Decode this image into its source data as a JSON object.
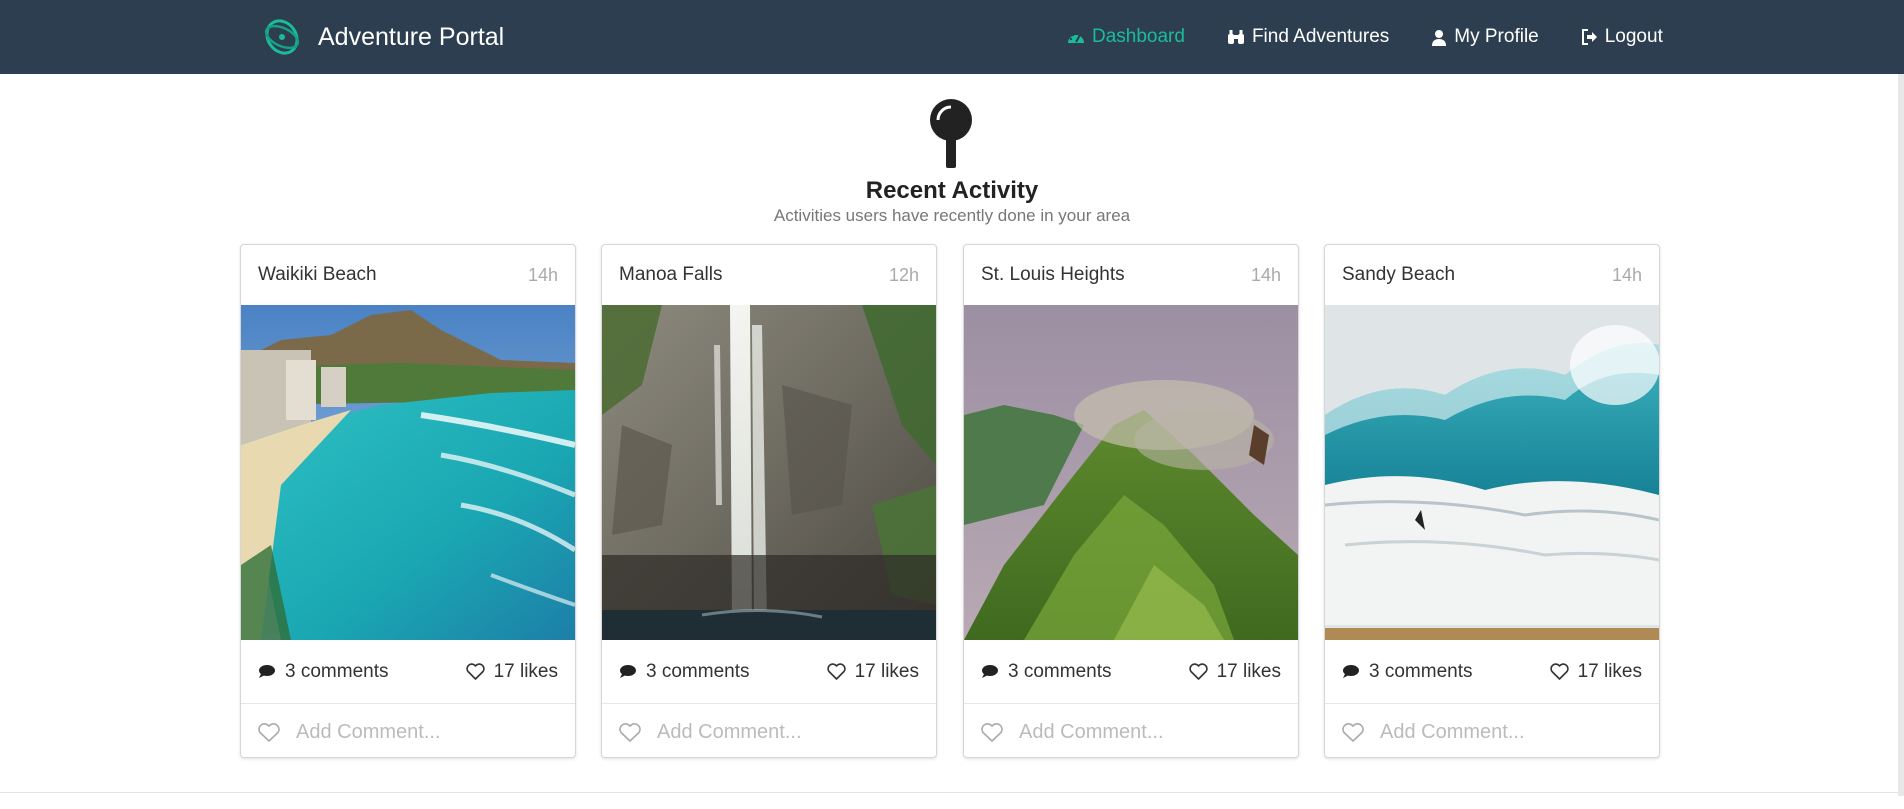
{
  "app": {
    "title": "Adventure Portal"
  },
  "nav": [
    {
      "label": "Dashboard",
      "icon": "dashboard-icon",
      "active": true
    },
    {
      "label": "Find Adventures",
      "icon": "binoculars-icon",
      "active": false
    },
    {
      "label": "My Profile",
      "icon": "user-icon",
      "active": false
    },
    {
      "label": "Logout",
      "icon": "sign-out-icon",
      "active": false
    }
  ],
  "header": {
    "icon": "map-pin-icon",
    "title": "Recent Activity",
    "subtitle": "Activities users have recently done in your area"
  },
  "cards": [
    {
      "name": "Waikiki Beach",
      "time": "14h",
      "comments": "3 comments",
      "likes": "17 likes",
      "comment_placeholder": "Add Comment...",
      "photo": "beach-aerial"
    },
    {
      "name": "Manoa Falls",
      "time": "12h",
      "comments": "3 comments",
      "likes": "17 likes",
      "comment_placeholder": "Add Comment...",
      "photo": "waterfall"
    },
    {
      "name": "St. Louis Heights",
      "time": "14h",
      "comments": "3 comments",
      "likes": "17 likes",
      "comment_placeholder": "Add Comment...",
      "photo": "mountain-ridge"
    },
    {
      "name": "Sandy Beach",
      "time": "14h",
      "comments": "3 comments",
      "likes": "17 likes",
      "comment_placeholder": "Add Comment...",
      "photo": "crashing-wave"
    }
  ],
  "colors": {
    "navbar": "#2c3e50",
    "accent": "#1abc9c"
  }
}
